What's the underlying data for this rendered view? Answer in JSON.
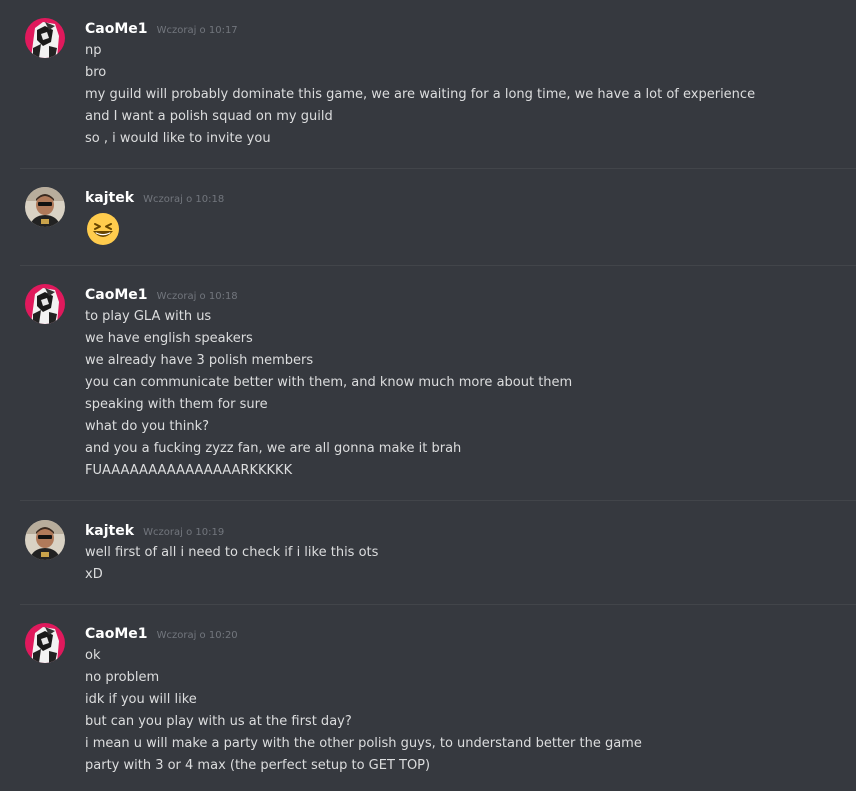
{
  "messages": [
    {
      "author": "CaoMe1",
      "timestamp": "Wczoraj o 10:17",
      "lines": [
        "np",
        "bro",
        "my guild will probably dominate this game, we are waiting for a long time, we have a lot of experience",
        "and I want a polish squad on my guild",
        "so , i would like to invite you"
      ]
    },
    {
      "author": "kajtek",
      "timestamp": "Wczoraj o 10:18",
      "emoji": "grinning-squinting-face-emoji"
    },
    {
      "author": "CaoMe1",
      "timestamp": "Wczoraj o 10:18",
      "lines": [
        "to play GLA with us",
        "we have english speakers",
        "we already have 3 polish members",
        "you can communicate better with them, and know much more about them",
        "speaking with them for sure",
        "what do you think?",
        "and you a fucking zyzz fan, we are all gonna make it brah",
        "FUAAAAAAAAAAAAAAARKKKKK"
      ]
    },
    {
      "author": "kajtek",
      "timestamp": "Wczoraj o 10:19",
      "lines": [
        "well first of all i need to check if i like this ots",
        "xD"
      ]
    },
    {
      "author": "CaoMe1",
      "timestamp": "Wczoraj o 10:20",
      "lines": [
        "ok",
        "no problem",
        "idk if you will like",
        "but can you play with us at the first day?",
        "i mean u will make a party with the other polish guys, to understand better the game",
        "party with 3 or 4 max (the perfect setup to GET TOP)"
      ]
    }
  ],
  "colors": {
    "background": "#36393f",
    "username": "#ffffff",
    "text": "#dcddde",
    "timestamp": "#72767d",
    "divider": "#42454a",
    "caome_avatar_accent": "#e0195c"
  }
}
